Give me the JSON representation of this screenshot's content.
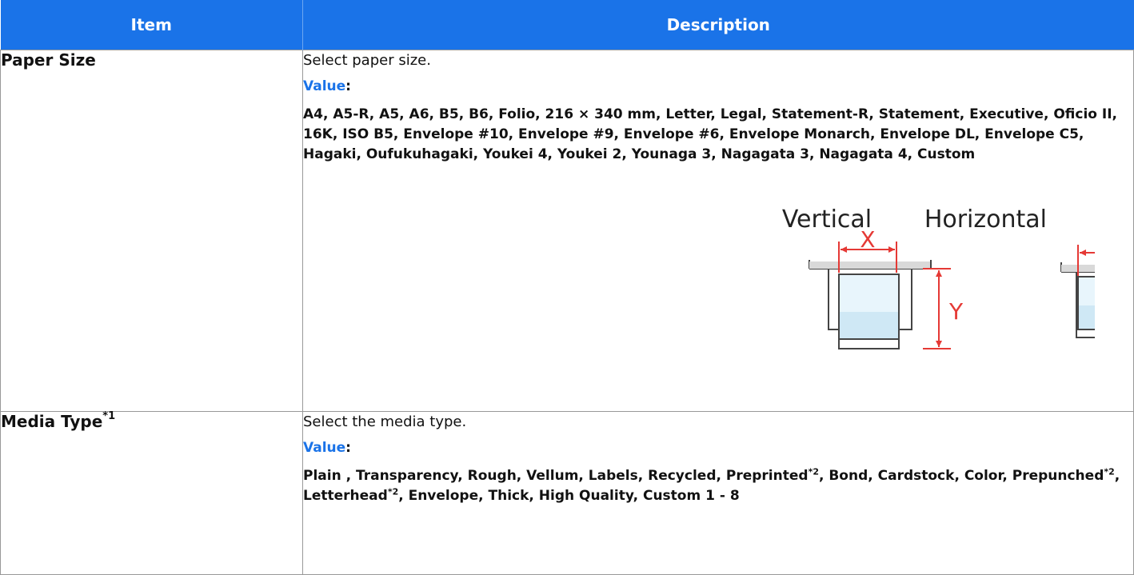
{
  "table": {
    "headers": {
      "item": "Item",
      "description": "Description"
    },
    "rows": [
      {
        "item": "Paper Size",
        "lead": "Select paper size.",
        "value_label": "Value",
        "value_colon": ":",
        "values": "A4, A5-R, A5, A6, B5, B6, Folio, 216 × 340 mm, Letter, Legal, Statement-R, Statement, Executive, Oficio II, 16K, ISO B5, Envelope #10, Envelope #9, Envelope #6, Envelope Monarch, Envelope DL, Envelope C5, Hagaki, Oufukuhagaki,  Youkei 4, Youkei 2, Younaga 3, Nagagata 3, Nagagata 4, Custom",
        "figure": {
          "vertical_label": "Vertical",
          "horizontal_label": "Horizontal",
          "x_marker": "X",
          "y_marker": "Y",
          "accent_color": "#e53935"
        }
      },
      {
        "item": "Media Type",
        "item_footnote": "*1",
        "lead": "Select the media type.",
        "value_label": "Value",
        "value_colon": ":",
        "values_a": "Plain , Transparency, Rough, Vellum, Labels, Recycled, Preprinted",
        "fn_a": "*2",
        "values_b": ", Bond, Cardstock, Color, Prepunched",
        "fn_b": "*2",
        "values_c": ", Letterhead",
        "fn_c": "*2",
        "values_d": ", Envelope, Thick, High Quality, Custom 1 - 8"
      }
    ]
  },
  "colors": {
    "header_bg": "#1a73e8",
    "value_label": "#1a73e8",
    "border": "#999999"
  }
}
